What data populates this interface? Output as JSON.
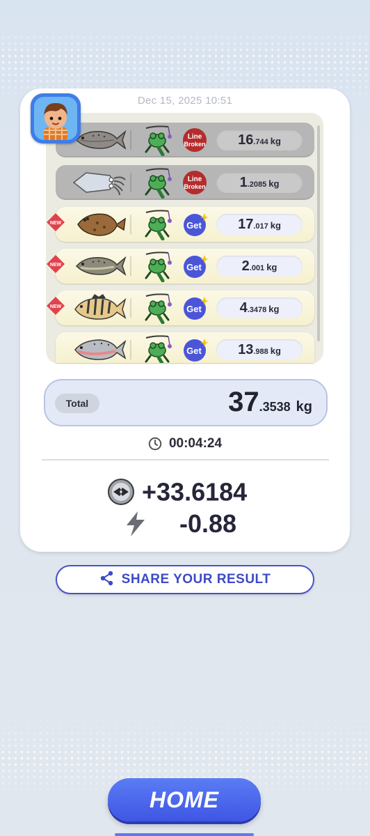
{
  "header": {
    "date": "Dec 15, 2025 10:51"
  },
  "catches": [
    {
      "fish": "trout-fish-icon",
      "status": "line_broken",
      "status_label_1": "Line",
      "status_label_2": "Broken",
      "weight_int": "16",
      "weight_dec": ".744",
      "unit": "kg",
      "is_new": false
    },
    {
      "fish": "squid-icon",
      "status": "line_broken",
      "status_label_1": "Line",
      "status_label_2": "Broken",
      "weight_int": "1",
      "weight_dec": ".2085",
      "unit": "kg",
      "is_new": false
    },
    {
      "fish": "flounder-fish-icon",
      "status": "get",
      "status_label": "Get",
      "weight_int": "17",
      "weight_dec": ".017",
      "unit": "kg",
      "is_new": true,
      "new_label": "NEW"
    },
    {
      "fish": "trout-fish-icon",
      "status": "get",
      "status_label": "Get",
      "weight_int": "2",
      "weight_dec": ".001",
      "unit": "kg",
      "is_new": true,
      "new_label": "NEW"
    },
    {
      "fish": "bass-fish-icon",
      "status": "get",
      "status_label": "Get",
      "weight_int": "4",
      "weight_dec": ".3478",
      "unit": "kg",
      "is_new": true,
      "new_label": "NEW"
    },
    {
      "fish": "salmon-fish-icon",
      "status": "get",
      "status_label": "Get",
      "weight_int": "13",
      "weight_dec": ".988",
      "unit": "kg",
      "is_new": false
    }
  ],
  "total": {
    "label": "Total",
    "int": "37",
    "dec": ".3538",
    "unit": "kg"
  },
  "time": {
    "value": "00:04:24"
  },
  "rewards": {
    "coins": "+33.6184",
    "energy": "-0.88"
  },
  "buttons": {
    "share": "SHARE YOUR RESULT",
    "home": "HOME"
  },
  "colors": {
    "accent": "#4651c8",
    "get_badge": "#4a55d8",
    "broken_badge": "#b42c2c",
    "new_badge": "#e0434d"
  }
}
